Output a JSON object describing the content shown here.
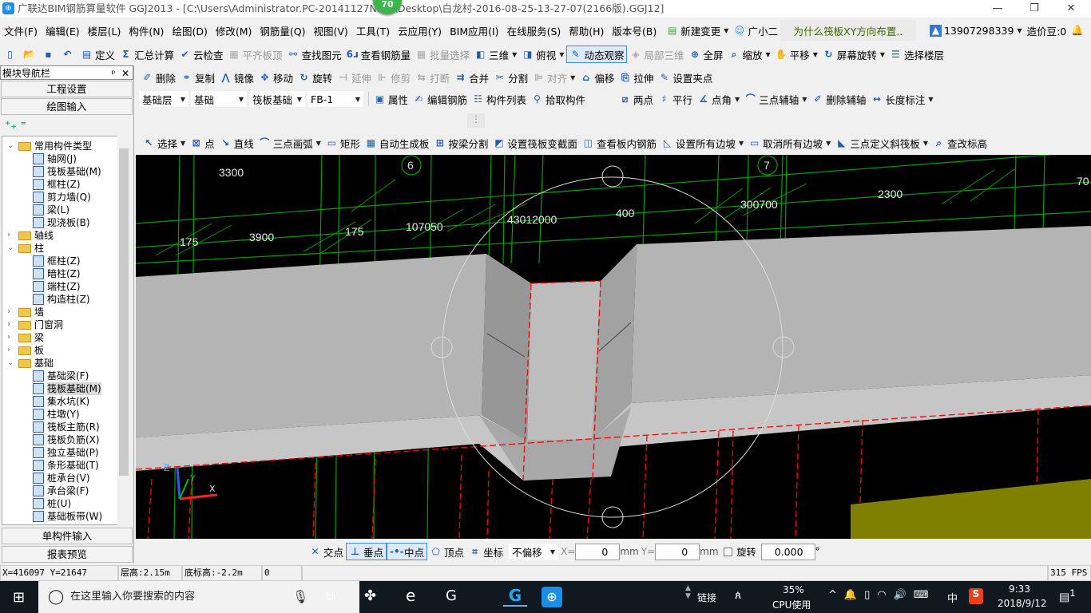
{
  "title": {
    "text": "广联达BIM钢筋算量软件 GGJ2013 - [C:\\Users\\Administrator.PC-20141127NRHI\\Desktop\\白龙村-2016-08-25-13-27-07(2166版).GGJ12]",
    "badge": "70"
  },
  "menu": [
    "文件(F)",
    "编辑(E)",
    "楼层(L)",
    "构件(N)",
    "绘图(D)",
    "修改(M)",
    "钢筋量(Q)",
    "视图(V)",
    "工具(T)",
    "云应用(Y)",
    "BIM应用(I)",
    "在线服务(S)",
    "帮助(H)",
    "版本号(B)"
  ],
  "menu_right": {
    "new_change": "新建变更",
    "assistant": "广小二",
    "question": "为什么筏板XY方向布置..",
    "phone": "13907298339",
    "beans": "造价豆:0"
  },
  "toolbar1": [
    {
      "label": "",
      "icon": "new-file-icon"
    },
    {
      "label": "",
      "icon": "open-folder-icon"
    },
    {
      "label": "",
      "icon": "save-icon"
    },
    {
      "label": "",
      "icon": "undo-icon"
    },
    {
      "label": "定义",
      "icon": "define-icon"
    },
    {
      "label": "汇总计算",
      "icon": "sigma-icon"
    },
    {
      "label": "云检查",
      "icon": "cloud-check-icon"
    },
    {
      "label": "平齐板顶",
      "icon": "align-top-icon",
      "disabled": true
    },
    {
      "label": "查找图元",
      "icon": "binoculars-icon"
    },
    {
      "label": "查看钢筋量",
      "icon": "view-rebar-icon"
    },
    {
      "label": "批量选择",
      "icon": "batch-select-icon",
      "disabled": true
    },
    {
      "label": "三维",
      "icon": "cube-icon",
      "dd": true
    },
    {
      "label": "俯视",
      "icon": "top-view-icon",
      "dd": true
    },
    {
      "label": "动态观察",
      "icon": "orbit-icon",
      "active": true
    },
    {
      "label": "局部三维",
      "icon": "partial-3d-icon",
      "disabled": true
    },
    {
      "label": "全屏",
      "icon": "fullscreen-icon"
    },
    {
      "label": "缩放",
      "icon": "zoom-icon",
      "dd": true
    },
    {
      "label": "平移",
      "icon": "pan-icon",
      "dd": true
    },
    {
      "label": "屏幕旋转",
      "icon": "rotate-screen-icon",
      "dd": true
    },
    {
      "label": "选择楼层",
      "icon": "select-floor-icon"
    }
  ],
  "toolbar2": [
    {
      "label": "删除",
      "icon": "delete-icon"
    },
    {
      "label": "复制",
      "icon": "copy-icon"
    },
    {
      "label": "镜像",
      "icon": "mirror-icon"
    },
    {
      "label": "移动",
      "icon": "move-icon"
    },
    {
      "label": "旋转",
      "icon": "rotate-icon"
    },
    {
      "label": "延伸",
      "icon": "extend-icon",
      "disabled": true
    },
    {
      "label": "修剪",
      "icon": "trim-icon",
      "disabled": true
    },
    {
      "label": "打断",
      "icon": "break-icon",
      "disabled": true
    },
    {
      "label": "合并",
      "icon": "merge-icon"
    },
    {
      "label": "分割",
      "icon": "split-icon"
    },
    {
      "label": "对齐",
      "icon": "align-icon",
      "disabled": true,
      "dd": true
    },
    {
      "label": "偏移",
      "icon": "offset-icon"
    },
    {
      "label": "拉伸",
      "icon": "stretch-icon"
    },
    {
      "label": "设置夹点",
      "icon": "grip-icon"
    }
  ],
  "selectors": {
    "floor": "基础层",
    "category": "基础",
    "type": "筏板基础",
    "name": "FB-1"
  },
  "toolbar3": [
    {
      "label": "属性",
      "icon": "properties-icon"
    },
    {
      "label": "编辑钢筋",
      "icon": "edit-rebar-icon"
    },
    {
      "label": "构件列表",
      "icon": "list-icon"
    },
    {
      "label": "拾取构件",
      "icon": "pick-icon"
    }
  ],
  "toolbar3b": [
    {
      "label": "两点",
      "icon": "two-point-icon"
    },
    {
      "label": "平行",
      "icon": "parallel-icon"
    },
    {
      "label": "点角",
      "icon": "point-angle-icon",
      "dd": true
    },
    {
      "label": "三点辅轴",
      "icon": "three-point-axis-icon",
      "dd": true
    },
    {
      "label": "删除辅轴",
      "icon": "delete-axis-icon"
    },
    {
      "label": "长度标注",
      "icon": "dimension-icon",
      "dd": true
    }
  ],
  "toolbar4": [
    {
      "label": "选择",
      "icon": "cursor-icon",
      "dd": true
    },
    {
      "label": "点",
      "icon": "point-icon"
    },
    {
      "label": "直线",
      "icon": "line-icon"
    },
    {
      "label": "三点画弧",
      "icon": "arc-icon",
      "dd": true
    },
    {
      "label": "矩形",
      "icon": "rectangle-icon"
    },
    {
      "label": "自动生成板",
      "icon": "auto-slab-icon"
    },
    {
      "label": "按梁分割",
      "icon": "split-by-beam-icon"
    },
    {
      "label": "设置筏板变截面",
      "icon": "variable-section-icon"
    },
    {
      "label": "查看板内钢筋",
      "icon": "view-slab-rebar-icon"
    },
    {
      "label": "设置所有边坡",
      "icon": "set-slope-icon",
      "dd": true
    },
    {
      "label": "取消所有边坡",
      "icon": "cancel-slope-icon",
      "dd": true
    },
    {
      "label": "三点定义斜筏板",
      "icon": "sloped-slab-icon",
      "dd": true
    },
    {
      "label": "查改标高",
      "icon": "elevation-icon"
    }
  ],
  "left_panel": {
    "title": "模块导航栏",
    "project_settings": "工程设置",
    "drawing_input": "绘图输入",
    "single_input": "单构件输入",
    "report_preview": "报表预览",
    "tree": [
      {
        "label": "常用构件类型",
        "level": 0,
        "folder": true,
        "open": true
      },
      {
        "label": "轴网(J)",
        "level": 1
      },
      {
        "label": "筏板基础(M)",
        "level": 1
      },
      {
        "label": "框柱(Z)",
        "level": 1
      },
      {
        "label": "剪力墙(Q)",
        "level": 1
      },
      {
        "label": "梁(L)",
        "level": 1
      },
      {
        "label": "现浇板(B)",
        "level": 1
      },
      {
        "label": "轴线",
        "level": 0,
        "folder": true
      },
      {
        "label": "柱",
        "level": 0,
        "folder": true,
        "open": true
      },
      {
        "label": "框柱(Z)",
        "level": 1
      },
      {
        "label": "暗柱(Z)",
        "level": 1
      },
      {
        "label": "端柱(Z)",
        "level": 1
      },
      {
        "label": "构造柱(Z)",
        "level": 1
      },
      {
        "label": "墙",
        "level": 0,
        "folder": true
      },
      {
        "label": "门窗洞",
        "level": 0,
        "folder": true
      },
      {
        "label": "梁",
        "level": 0,
        "folder": true
      },
      {
        "label": "板",
        "level": 0,
        "folder": true
      },
      {
        "label": "基础",
        "level": 0,
        "folder": true,
        "open": true
      },
      {
        "label": "基础梁(F)",
        "level": 1
      },
      {
        "label": "筏板基础(M)",
        "level": 1,
        "selected": true
      },
      {
        "label": "集水坑(K)",
        "level": 1
      },
      {
        "label": "柱墩(Y)",
        "level": 1
      },
      {
        "label": "筏板主筋(R)",
        "level": 1
      },
      {
        "label": "筏板负筋(X)",
        "level": 1
      },
      {
        "label": "独立基础(P)",
        "level": 1
      },
      {
        "label": "条形基础(T)",
        "level": 1
      },
      {
        "label": "桩承台(V)",
        "level": 1
      },
      {
        "label": "承台梁(F)",
        "level": 1
      },
      {
        "label": "桩(U)",
        "level": 1
      },
      {
        "label": "基础板带(W)",
        "level": 1
      }
    ]
  },
  "canvas": {
    "axis_labels": [
      "6",
      "7"
    ],
    "dims": [
      {
        "t": "3300"
      },
      {
        "t": "175"
      },
      {
        "t": "3900"
      },
      {
        "t": "175"
      },
      {
        "t": "107050"
      },
      {
        "t": "43012000"
      },
      {
        "t": "400"
      },
      {
        "t": "300700"
      },
      {
        "t": "2300"
      },
      {
        "t": "70"
      }
    ],
    "colors": {
      "grid": "#00a000",
      "slab": "#b4b4b4",
      "edge": "#ff0000",
      "block": "#808000"
    }
  },
  "snap": {
    "intersection": "交点",
    "perpendicular": "垂点",
    "midpoint": "中点",
    "vertex": "顶点",
    "coordinate": "坐标",
    "offset_mode": "不偏移",
    "x_label": "X=",
    "x_value": "0",
    "y_label": "Y=",
    "y_value": "0",
    "unit": "mm",
    "rotate_label": "旋转",
    "rotate_value": "0.000",
    "degree": "°"
  },
  "status": {
    "coords": "X=416097 Y=21647",
    "floor_height": "层高:2.15m",
    "base_elev": "底标高:-2.2m",
    "value": "0",
    "fps": "315 FPS"
  },
  "taskbar": {
    "search_placeholder": "在这里输入你要搜索的内容",
    "link": "链接",
    "cpu_percent": "35%",
    "cpu_label": "CPU使用",
    "ime": "中",
    "time": "9:33",
    "date": "2018/9/12",
    "notifications": "1"
  }
}
